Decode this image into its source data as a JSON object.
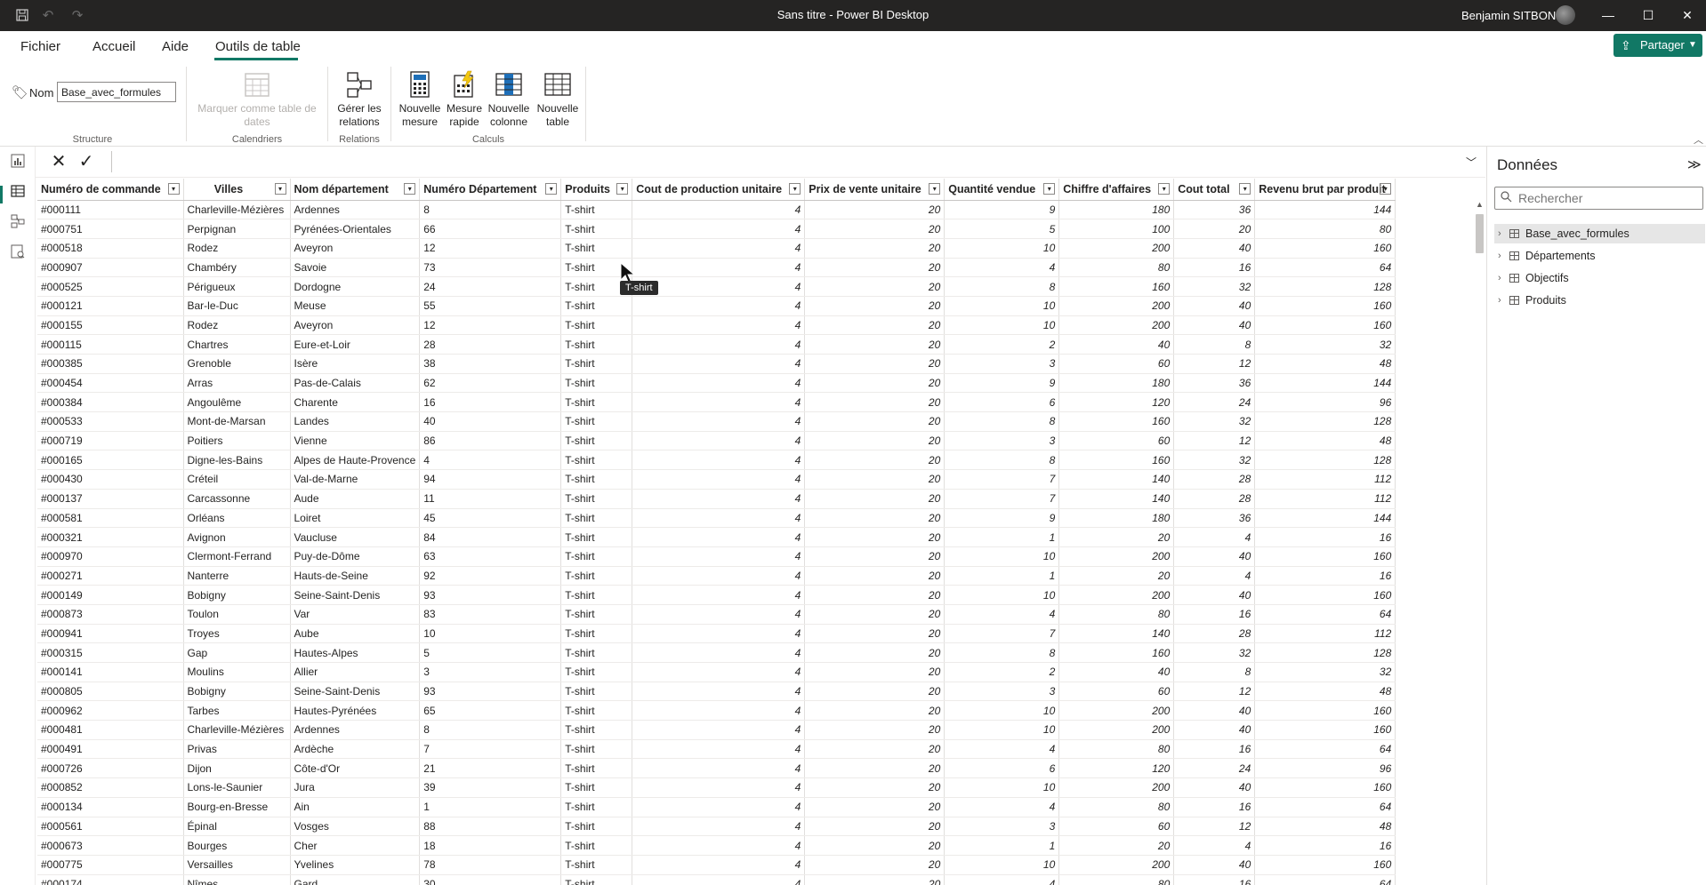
{
  "window": {
    "title": "Sans titre - Power BI Desktop",
    "user_name": "Benjamin SITBON",
    "minimize": "—",
    "maximize": "☐",
    "close": "✕"
  },
  "menu": {
    "tabs": [
      "Fichier",
      "Accueil",
      "Aide",
      "Outils de table"
    ],
    "active_tab": "Outils de table",
    "share_label": "Partager"
  },
  "ribbon": {
    "name_label": "Nom",
    "name_value": "Base_avec_formules",
    "groups": {
      "structure": "Structure",
      "calendriers": "Calendriers",
      "relations": "Relations",
      "calculs": "Calculs"
    },
    "buttons": {
      "mark_date_table": "Marquer comme table de dates",
      "manage_relations": "Gérer les relations",
      "new_measure": "Nouvelle mesure",
      "quick_measure": "Mesure rapide",
      "new_column": "Nouvelle colonne",
      "new_table": "Nouvelle table"
    }
  },
  "table": {
    "columns": [
      "Numéro de commande",
      "Villes",
      "Nom département",
      "Numéro Département",
      "Produits",
      "Cout de production unitaire",
      "Prix de vente unitaire",
      "Quantité vendue",
      "Chiffre d'affaires",
      "Cout total",
      "Revenu brut par produit"
    ],
    "rows": [
      [
        "#000111",
        "Charleville-Mézières",
        "Ardennes",
        "8",
        "T-shirt",
        "4",
        "20",
        "9",
        "180",
        "36",
        "144"
      ],
      [
        "#000751",
        "Perpignan",
        "Pyrénées-Orientales",
        "66",
        "T-shirt",
        "4",
        "20",
        "5",
        "100",
        "20",
        "80"
      ],
      [
        "#000518",
        "Rodez",
        "Aveyron",
        "12",
        "T-shirt",
        "4",
        "20",
        "10",
        "200",
        "40",
        "160"
      ],
      [
        "#000907",
        "Chambéry",
        "Savoie",
        "73",
        "T-shirt",
        "4",
        "20",
        "4",
        "80",
        "16",
        "64"
      ],
      [
        "#000525",
        "Périgueux",
        "Dordogne",
        "24",
        "T-shirt",
        "4",
        "20",
        "8",
        "160",
        "32",
        "128"
      ],
      [
        "#000121",
        "Bar-le-Duc",
        "Meuse",
        "55",
        "T-shirt",
        "4",
        "20",
        "10",
        "200",
        "40",
        "160"
      ],
      [
        "#000155",
        "Rodez",
        "Aveyron",
        "12",
        "T-shirt",
        "4",
        "20",
        "10",
        "200",
        "40",
        "160"
      ],
      [
        "#000115",
        "Chartres",
        "Eure-et-Loir",
        "28",
        "T-shirt",
        "4",
        "20",
        "2",
        "40",
        "8",
        "32"
      ],
      [
        "#000385",
        "Grenoble",
        "Isère",
        "38",
        "T-shirt",
        "4",
        "20",
        "3",
        "60",
        "12",
        "48"
      ],
      [
        "#000454",
        "Arras",
        "Pas-de-Calais",
        "62",
        "T-shirt",
        "4",
        "20",
        "9",
        "180",
        "36",
        "144"
      ],
      [
        "#000384",
        "Angoulême",
        "Charente",
        "16",
        "T-shirt",
        "4",
        "20",
        "6",
        "120",
        "24",
        "96"
      ],
      [
        "#000533",
        "Mont-de-Marsan",
        "Landes",
        "40",
        "T-shirt",
        "4",
        "20",
        "8",
        "160",
        "32",
        "128"
      ],
      [
        "#000719",
        "Poitiers",
        "Vienne",
        "86",
        "T-shirt",
        "4",
        "20",
        "3",
        "60",
        "12",
        "48"
      ],
      [
        "#000165",
        "Digne-les-Bains",
        "Alpes de Haute-Provence",
        "4",
        "T-shirt",
        "4",
        "20",
        "8",
        "160",
        "32",
        "128"
      ],
      [
        "#000430",
        "Créteil",
        "Val-de-Marne",
        "94",
        "T-shirt",
        "4",
        "20",
        "7",
        "140",
        "28",
        "112"
      ],
      [
        "#000137",
        "Carcassonne",
        "Aude",
        "11",
        "T-shirt",
        "4",
        "20",
        "7",
        "140",
        "28",
        "112"
      ],
      [
        "#000581",
        "Orléans",
        "Loiret",
        "45",
        "T-shirt",
        "4",
        "20",
        "9",
        "180",
        "36",
        "144"
      ],
      [
        "#000321",
        "Avignon",
        "Vaucluse",
        "84",
        "T-shirt",
        "4",
        "20",
        "1",
        "20",
        "4",
        "16"
      ],
      [
        "#000970",
        "Clermont-Ferrand",
        "Puy-de-Dôme",
        "63",
        "T-shirt",
        "4",
        "20",
        "10",
        "200",
        "40",
        "160"
      ],
      [
        "#000271",
        "Nanterre",
        "Hauts-de-Seine",
        "92",
        "T-shirt",
        "4",
        "20",
        "1",
        "20",
        "4",
        "16"
      ],
      [
        "#000149",
        "Bobigny",
        "Seine-Saint-Denis",
        "93",
        "T-shirt",
        "4",
        "20",
        "10",
        "200",
        "40",
        "160"
      ],
      [
        "#000873",
        "Toulon",
        "Var",
        "83",
        "T-shirt",
        "4",
        "20",
        "4",
        "80",
        "16",
        "64"
      ],
      [
        "#000941",
        "Troyes",
        "Aube",
        "10",
        "T-shirt",
        "4",
        "20",
        "7",
        "140",
        "28",
        "112"
      ],
      [
        "#000315",
        "Gap",
        "Hautes-Alpes",
        "5",
        "T-shirt",
        "4",
        "20",
        "8",
        "160",
        "32",
        "128"
      ],
      [
        "#000141",
        "Moulins",
        "Allier",
        "3",
        "T-shirt",
        "4",
        "20",
        "2",
        "40",
        "8",
        "32"
      ],
      [
        "#000805",
        "Bobigny",
        "Seine-Saint-Denis",
        "93",
        "T-shirt",
        "4",
        "20",
        "3",
        "60",
        "12",
        "48"
      ],
      [
        "#000962",
        "Tarbes",
        "Hautes-Pyrénées",
        "65",
        "T-shirt",
        "4",
        "20",
        "10",
        "200",
        "40",
        "160"
      ],
      [
        "#000481",
        "Charleville-Mézières",
        "Ardennes",
        "8",
        "T-shirt",
        "4",
        "20",
        "10",
        "200",
        "40",
        "160"
      ],
      [
        "#000491",
        "Privas",
        "Ardèche",
        "7",
        "T-shirt",
        "4",
        "20",
        "4",
        "80",
        "16",
        "64"
      ],
      [
        "#000726",
        "Dijon",
        "Côte-d'Or",
        "21",
        "T-shirt",
        "4",
        "20",
        "6",
        "120",
        "24",
        "96"
      ],
      [
        "#000852",
        "Lons-le-Saunier",
        "Jura",
        "39",
        "T-shirt",
        "4",
        "20",
        "10",
        "200",
        "40",
        "160"
      ],
      [
        "#000134",
        "Bourg-en-Bresse",
        "Ain",
        "1",
        "T-shirt",
        "4",
        "20",
        "4",
        "80",
        "16",
        "64"
      ],
      [
        "#000561",
        "Épinal",
        "Vosges",
        "88",
        "T-shirt",
        "4",
        "20",
        "3",
        "60",
        "12",
        "48"
      ],
      [
        "#000673",
        "Bourges",
        "Cher",
        "18",
        "T-shirt",
        "4",
        "20",
        "1",
        "20",
        "4",
        "16"
      ],
      [
        "#000775",
        "Versailles",
        "Yvelines",
        "78",
        "T-shirt",
        "4",
        "20",
        "10",
        "200",
        "40",
        "160"
      ],
      [
        "#000174",
        "Nîmes",
        "Gard",
        "30",
        "T-shirt",
        "4",
        "20",
        "4",
        "80",
        "16",
        "64"
      ]
    ],
    "tooltip": "T-shirt"
  },
  "data_pane": {
    "title": "Données",
    "search_placeholder": "Rechercher",
    "tables": [
      "Base_avec_formules",
      "Départements",
      "Objectifs",
      "Produits"
    ],
    "selected_table": "Base_avec_formules"
  },
  "colors": {
    "accent": "#117865",
    "titlebar": "#252423"
  }
}
